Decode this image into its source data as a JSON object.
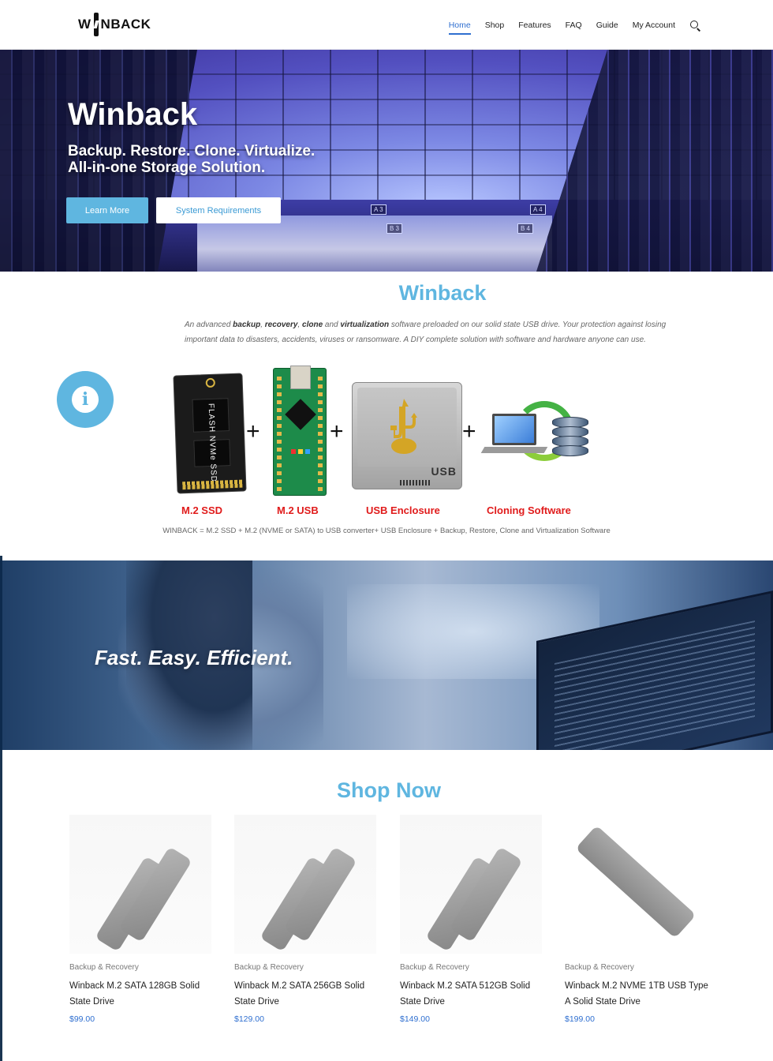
{
  "header": {
    "logo": {
      "w": "W",
      "nback": "NBACK"
    },
    "nav": [
      "Home",
      "Shop",
      "Features",
      "FAQ",
      "Guide",
      "My Account"
    ],
    "active": "Home"
  },
  "hero": {
    "title": "Winback",
    "subtitle_line1": "Backup. Restore. Clone. Virtualize.",
    "subtitle_line2": "All-in-one Storage Solution.",
    "primary_button": "Learn More",
    "secondary_button": "System Requirements",
    "signs": [
      "A 3",
      "B 3",
      "A 4",
      "B 4"
    ]
  },
  "about": {
    "title": "Winback",
    "text": {
      "p1": "An advanced ",
      "b1": "backup",
      "p2": ", ",
      "b2": "recovery",
      "p3": ", ",
      "b3": "clone",
      "p4": " and ",
      "b4": "virtualization",
      "p5": " software preloaded on our solid state USB drive. Your protection against losing important data to disasters, accidents, viruses or ransomware. A DIY complete solution with software and hardware anyone can use."
    },
    "components": [
      "M.2 SSD",
      "M.2 USB",
      "USB Enclosure",
      "Cloning Software"
    ],
    "ssd_chip_text": "FLASH NVMe SSD",
    "enclosure_text": "USB",
    "plus": "+",
    "formula": "WINBACK = M.2 SSD + M.2 (NVME or SATA) to USB converter+ USB Enclosure + Backup, Restore, Clone and Virtualization Software"
  },
  "banner": {
    "tagline": "Fast. Easy. Efficient."
  },
  "shop": {
    "title": "Shop Now",
    "products": [
      {
        "category": "Backup & Recovery",
        "name": "Winback M.2 SATA 128GB Solid State Drive",
        "price": "$99.00"
      },
      {
        "category": "Backup & Recovery",
        "name": "Winback M.2 SATA 256GB Solid State Drive",
        "price": "$129.00"
      },
      {
        "category": "Backup & Recovery",
        "name": "Winback M.2 SATA 512GB Solid State Drive",
        "price": "$149.00"
      },
      {
        "category": "Backup & Recovery",
        "name": "Winback M.2 NVME 1TB USB Type A Solid State Drive",
        "price": "$199.00"
      }
    ]
  },
  "colors": {
    "accent": "#5fb6e0",
    "link": "#2f6fd0",
    "component_label": "#e01b1b"
  },
  "icons": [
    "search-icon",
    "info-icon",
    "usb-icon"
  ]
}
